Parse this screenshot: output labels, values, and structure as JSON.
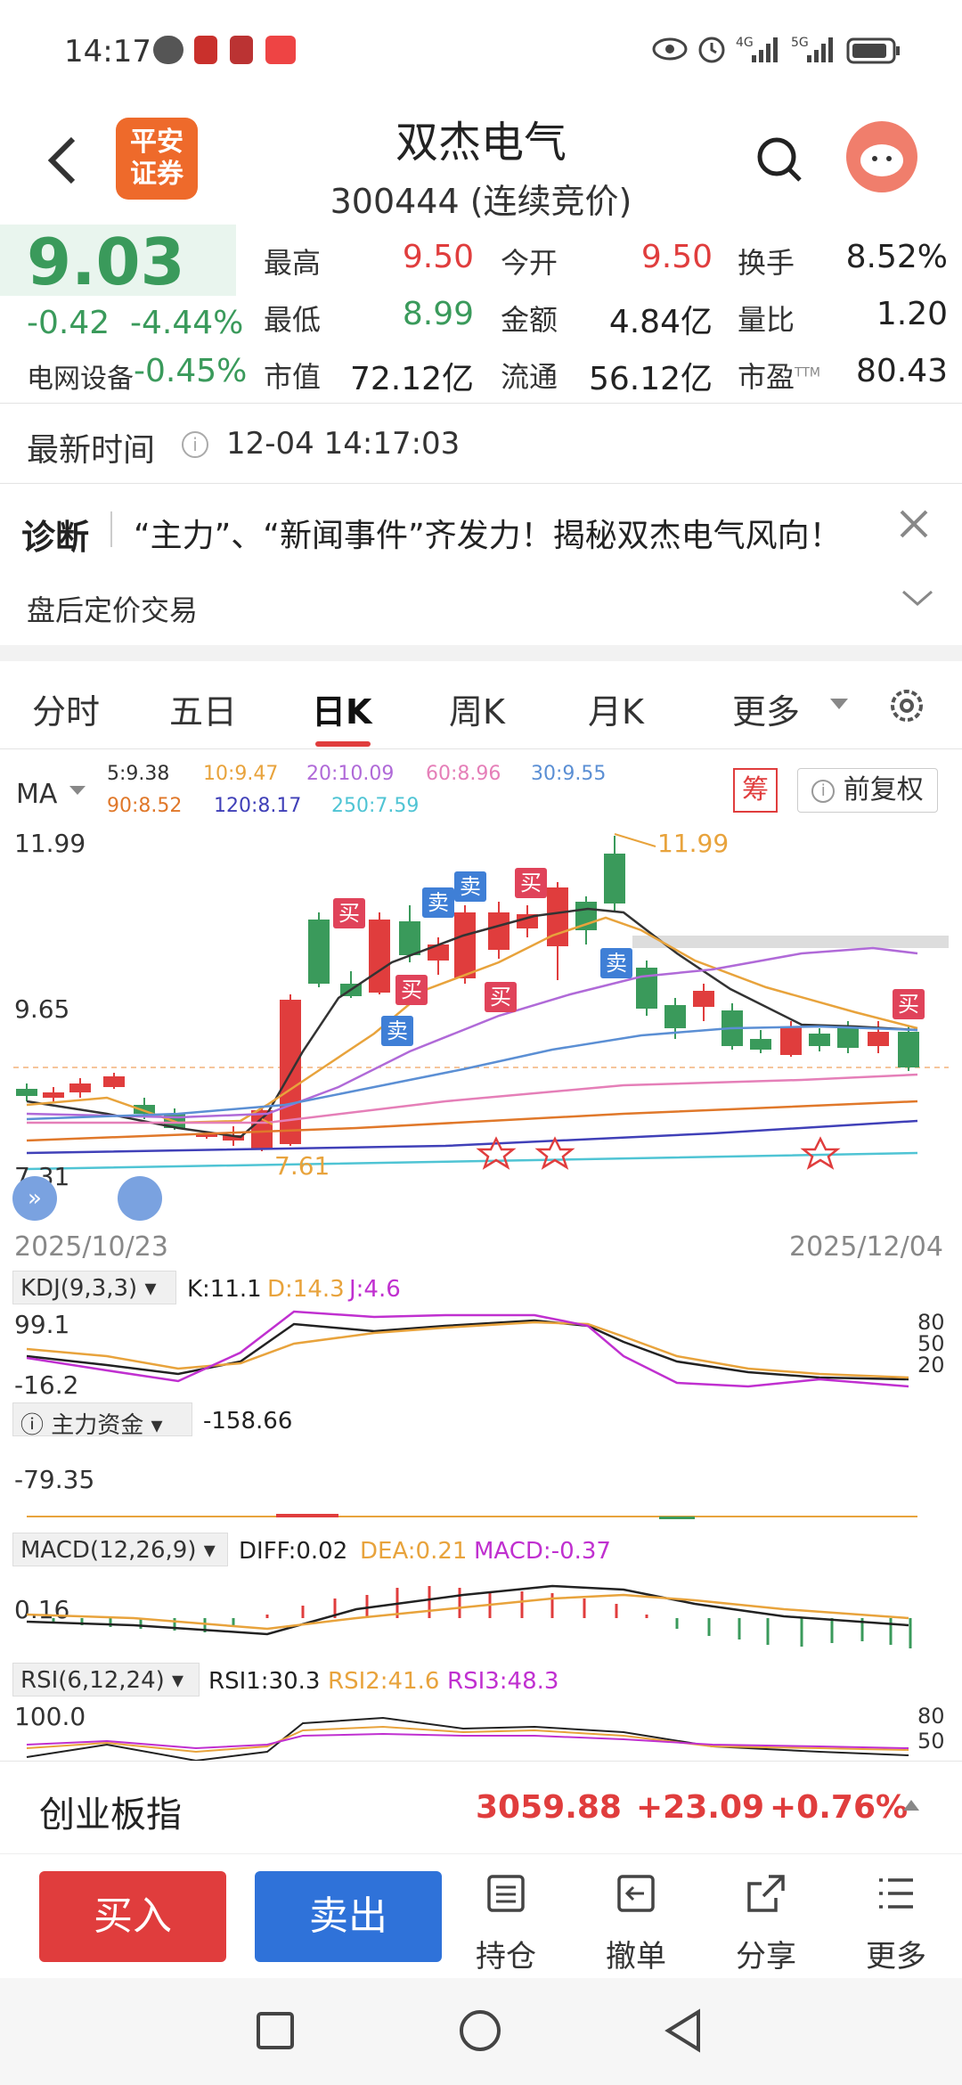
{
  "status": {
    "time": "14:17",
    "net1": "4G",
    "net2": "5G"
  },
  "header": {
    "logo_line1": "平安",
    "logo_line2": "证券",
    "title": "双杰电气",
    "subtitle": "300444 (连续竞价)"
  },
  "quote": {
    "price": "9.03",
    "change": "-0.42",
    "change_pct": "-4.44%",
    "sector_name": "电网设备",
    "sector_pct": "-0.45%",
    "fields": [
      {
        "label": "最高",
        "value": "9.50",
        "color": "red"
      },
      {
        "label": "今开",
        "value": "9.50",
        "color": "red"
      },
      {
        "label": "换手",
        "value": "8.52%",
        "color": "dark"
      },
      {
        "label": "最低",
        "value": "8.99",
        "color": "green"
      },
      {
        "label": "金额",
        "value": "4.84亿",
        "color": "dark"
      },
      {
        "label": "量比",
        "value": "1.20",
        "color": "dark"
      },
      {
        "label": "市值",
        "value": "72.12亿",
        "color": "dark"
      },
      {
        "label": "流通",
        "value": "56.12亿",
        "color": "dark"
      },
      {
        "label": "市盈",
        "value": "80.43",
        "color": "dark",
        "sup": "TTM"
      }
    ]
  },
  "latest_time": {
    "label": "最新时间",
    "value": "12-04 14:17:03"
  },
  "diagnosis": {
    "label": "诊断",
    "text": "“主力”、“新闻事件”齐发力！揭秘双杰电气风向！",
    "after_hours": "盘后定价交易"
  },
  "tabs": [
    "分时",
    "五日",
    "日K",
    "周K",
    "月K",
    "更多"
  ],
  "active_tab": "日K",
  "chart": {
    "ma_label": "MA",
    "ma_row1": [
      "5:9.38",
      "10:9.47",
      "20:10.09",
      "60:8.96",
      "30:9.55"
    ],
    "ma_row2": [
      "90:8.52",
      "120:8.17",
      "250:7.59"
    ],
    "chip_label": "筹",
    "adjust_label": "前复权",
    "y_top": "11.99",
    "y_mid": "9.65",
    "y_low": "7.31",
    "max_label": "11.99",
    "min_label": "7.61",
    "date_start": "2025/10/23",
    "date_end": "2025/12/04",
    "buy_tag": "买",
    "sell_tag": "卖"
  },
  "chart_data": {
    "type": "candlestick",
    "x_start": "2025/10/23",
    "x_end": "2025/12/04",
    "ylim": [
      7.31,
      11.99
    ],
    "high": 11.99,
    "low": 7.61,
    "last_close": 9.03
  },
  "indicators": {
    "kdj": {
      "name": "KDJ(9,3,3)",
      "k": "K:11.1",
      "d": "D:14.3",
      "j": "J:4.6",
      "top": "99.1",
      "bottom": "-16.2",
      "r80": "80",
      "r50": "50",
      "r20": "20"
    },
    "flow": {
      "name": "主力资金",
      "value": "-158.66",
      "axis": "-79.35"
    },
    "macd": {
      "name": "MACD(12,26,9)",
      "diff": "DIFF:0.02",
      "dea": "DEA:0.21",
      "macd": "MACD:-0.37",
      "axis": "0.16"
    },
    "rsi": {
      "name": "RSI(6,12,24)",
      "r1": "RSI1:30.3",
      "r2": "RSI2:41.6",
      "r3": "RSI3:48.3",
      "top": "100.0",
      "r80": "80",
      "r50": "50"
    }
  },
  "index_bar": {
    "name": "创业板指",
    "value": "3059.88",
    "change": "+23.09",
    "pct": "+0.76%"
  },
  "actions": {
    "buy": "买入",
    "sell": "卖出",
    "position": "持仓",
    "cancel": "撤单",
    "share": "分享",
    "more": "更多"
  }
}
